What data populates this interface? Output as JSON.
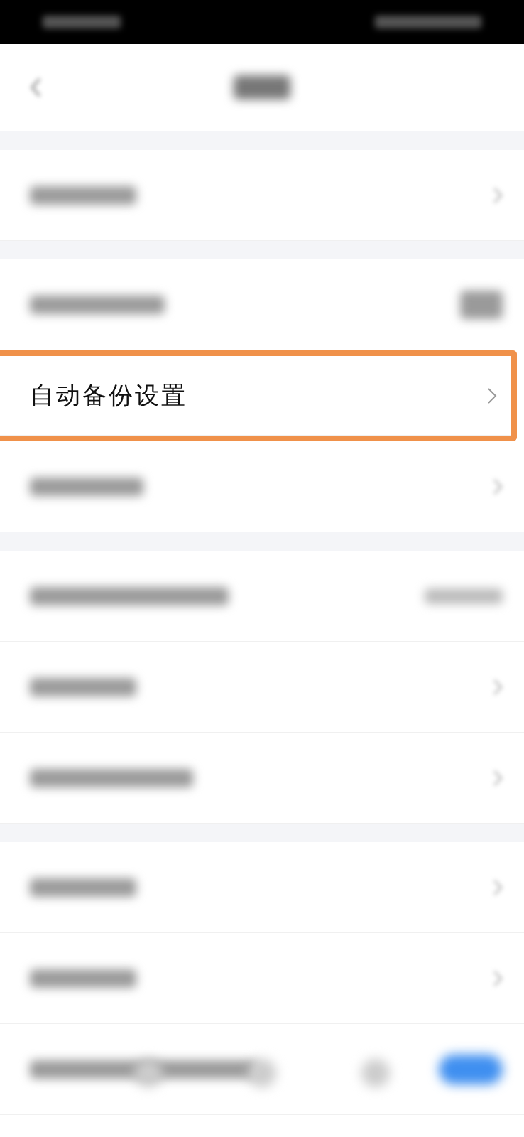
{
  "sections": [
    {
      "rows": [
        {
          "kind": "blurred",
          "trailing": {
            "kind": "chevron"
          },
          "highlighted": false
        }
      ]
    },
    {
      "rows": [
        {
          "kind": "blurred",
          "trailing": {
            "kind": "blurred-icon"
          },
          "highlighted": false
        },
        {
          "kind": "text",
          "label": "自动备份设置",
          "trailing": {
            "kind": "chevron"
          },
          "highlighted": true
        },
        {
          "kind": "blurred",
          "trailing": {
            "kind": "chevron"
          },
          "highlighted": false
        }
      ]
    },
    {
      "rows": [
        {
          "kind": "blurred",
          "trailing": {
            "kind": "blurred-value"
          },
          "highlighted": false
        },
        {
          "kind": "blurred",
          "trailing": {
            "kind": "chevron"
          },
          "highlighted": false
        },
        {
          "kind": "blurred",
          "trailing": {
            "kind": "chevron"
          },
          "highlighted": false
        }
      ]
    },
    {
      "rows": [
        {
          "kind": "blurred",
          "trailing": {
            "kind": "chevron"
          },
          "highlighted": false
        },
        {
          "kind": "blurred",
          "trailing": {
            "kind": "chevron"
          },
          "highlighted": false
        },
        {
          "kind": "blurred",
          "trailing": {
            "kind": "toggle",
            "on": true
          },
          "highlighted": false
        }
      ]
    }
  ]
}
